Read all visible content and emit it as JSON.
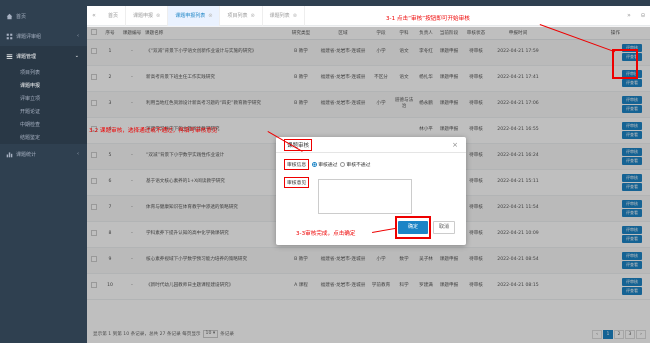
{
  "sidebar": {
    "home": "首页",
    "review": "课题评审组",
    "manage": "课题管理",
    "sub_items": [
      "项目列表",
      "课题申报",
      "评审立项",
      "开题论证",
      "中期检查",
      "结题鉴定"
    ],
    "stats": "课题统计"
  },
  "tabs": {
    "items": [
      "首页",
      "课题申报",
      "课题申报列表",
      "项目列表",
      "课题列表"
    ],
    "active_index": 2
  },
  "table": {
    "headers": [
      "序号",
      "课题编号",
      "课题名称",
      "研究类型",
      "区域",
      "学段",
      "学科",
      "负责人",
      "当前阶段",
      "审核状态",
      "申报时间",
      "操作"
    ],
    "rows": [
      {
        "idx": "1",
        "code": "-",
        "name": "《“双减”背景下小学语文创新作业设计与实施的研究》",
        "type": "B 教学",
        "region": "福建省-龙岩市-连城县",
        "stage": "小学",
        "subject": "语文",
        "leader": "李冬红",
        "phase": "课题申报",
        "status": "待审核",
        "time": "2022-04-21 17:59"
      },
      {
        "idx": "2",
        "code": "-",
        "name": "新高考背景下班主任工作实践研究",
        "type": "B 教学",
        "region": "福建省-龙岩市-连城县",
        "stage": "不区分",
        "subject": "语文",
        "leader": "杨扎华",
        "phase": "课题申报",
        "status": "待审核",
        "time": "2022-04-21 17:41"
      },
      {
        "idx": "3",
        "code": "-",
        "name": "利用当地红色资源设计新高考习题的“四史”教育教学研究",
        "type": "B 教学",
        "region": "福建省-龙岩市-连城县",
        "stage": "小学",
        "subject": "道德与法治",
        "leader": "杨永鹏",
        "phase": "课题申报",
        "status": "待审核",
        "time": "2022-04-21 17:06"
      },
      {
        "idx": "4",
        "code": "-",
        "name": "深度学习导向下的主题阅读教学研究",
        "type": "",
        "region": "",
        "stage": "",
        "subject": "",
        "leader": "林小平",
        "phase": "课题申报",
        "status": "待审核",
        "time": "2022-04-21 16:55"
      },
      {
        "idx": "5",
        "code": "-",
        "name": "“双减”背景下小学数学实践性作业设计",
        "type": "",
        "region": "",
        "stage": "",
        "subject": "",
        "leader": "李清芳",
        "phase": "课题申报",
        "status": "待审核",
        "time": "2022-04-21 16:24"
      },
      {
        "idx": "6",
        "code": "-",
        "name": "基于语文核心素养的1+X阅读教学研究",
        "type": "",
        "region": "",
        "stage": "",
        "subject": "",
        "leader": "马丹平",
        "phase": "课题申报",
        "status": "待审核",
        "time": "2022-04-21 15:11"
      },
      {
        "idx": "7",
        "code": "-",
        "name": "体育与健康知识在体育教学中渗透的策略研究",
        "type": "",
        "region": "",
        "stage": "",
        "subject": "",
        "leader": "曹锦清",
        "phase": "课题申报",
        "status": "待审核",
        "time": "2022-04-21 11:54"
      },
      {
        "idx": "8",
        "code": "-",
        "name": "学科素养下提升认知的高中化学微课研究",
        "type": "B 教学",
        "region": "福建省-龙岩市-连城县",
        "stage": "高级中学",
        "subject": "化学",
        "leader": "陈婷清",
        "phase": "课题申报",
        "status": "待审核",
        "time": "2022-04-21 10:09"
      },
      {
        "idx": "9",
        "code": "-",
        "name": "核心素养视域下小学数学预习能力培养的策略研究",
        "type": "B 教学",
        "region": "福建省-龙岩市-连城县",
        "stage": "小学",
        "subject": "数学",
        "leader": "吴子林",
        "phase": "课题申报",
        "status": "待审核",
        "time": "2022-04-21 08:54"
      },
      {
        "idx": "10",
        "code": "-",
        "name": "《新时代幼儿园教师日主题课程建设研究》",
        "type": "A 课程",
        "region": "福建省-龙岩市-连城县",
        "stage": "学前教育",
        "subject": "科学",
        "leader": "罗建满",
        "phase": "课题申报",
        "status": "待审核",
        "time": "2022-04-21 08:15"
      }
    ],
    "action_review": "评审核",
    "action_view": "评查看"
  },
  "footer": {
    "summary": "显示第 1 到第 10 条记录，总共 27 条记录 每页显示",
    "page_size": "10",
    "suffix": "条记录",
    "pages": [
      "‹",
      "1",
      "2",
      "3",
      "›"
    ],
    "active_page": "1"
  },
  "modal": {
    "title": "课题审核",
    "label_info": "审核信息",
    "option_pass": "审核通过",
    "option_fail": "审核不通过",
    "label_opinion": "审核意见",
    "ok": "确定",
    "cancel": "取消"
  },
  "annotations": {
    "a1": "3-1 点击“审核”按钮即可开始审核",
    "a2": "3-2 课题审核，选择通过或不通过，再填写审核意见",
    "a3": "3-3审核完成，点击确定"
  },
  "colors": {
    "sidebar_bg": "#2f4050",
    "accent": "#1c84c6",
    "annotation": "#e00000"
  }
}
